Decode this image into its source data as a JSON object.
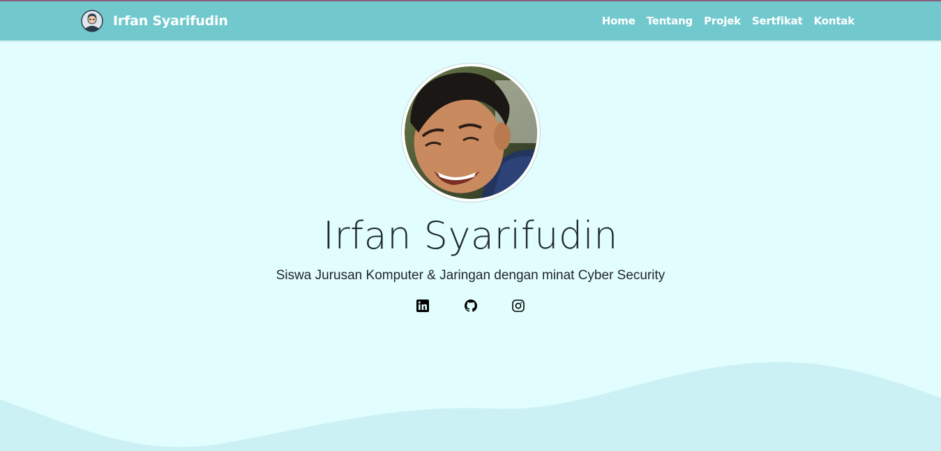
{
  "brand": {
    "name": "Irfan Syarifudin",
    "logo_icon": "user-avatar-icon"
  },
  "nav": {
    "items": [
      {
        "label": "Home"
      },
      {
        "label": "Tentang"
      },
      {
        "label": "Projek"
      },
      {
        "label": "Sertfikat"
      },
      {
        "label": "Kontak"
      }
    ]
  },
  "hero": {
    "name": "Irfan Syarifudin",
    "subtitle": "Siswa Jurusan Komputer & Jaringan dengan minat Cyber Security",
    "socials": [
      {
        "icon": "linkedin-icon"
      },
      {
        "icon": "github-icon"
      },
      {
        "icon": "instagram-icon"
      }
    ]
  },
  "colors": {
    "navbar": "#71c9ce",
    "background": "#e2fdfd",
    "wave": "#cbf1f5",
    "text": "#212529"
  }
}
